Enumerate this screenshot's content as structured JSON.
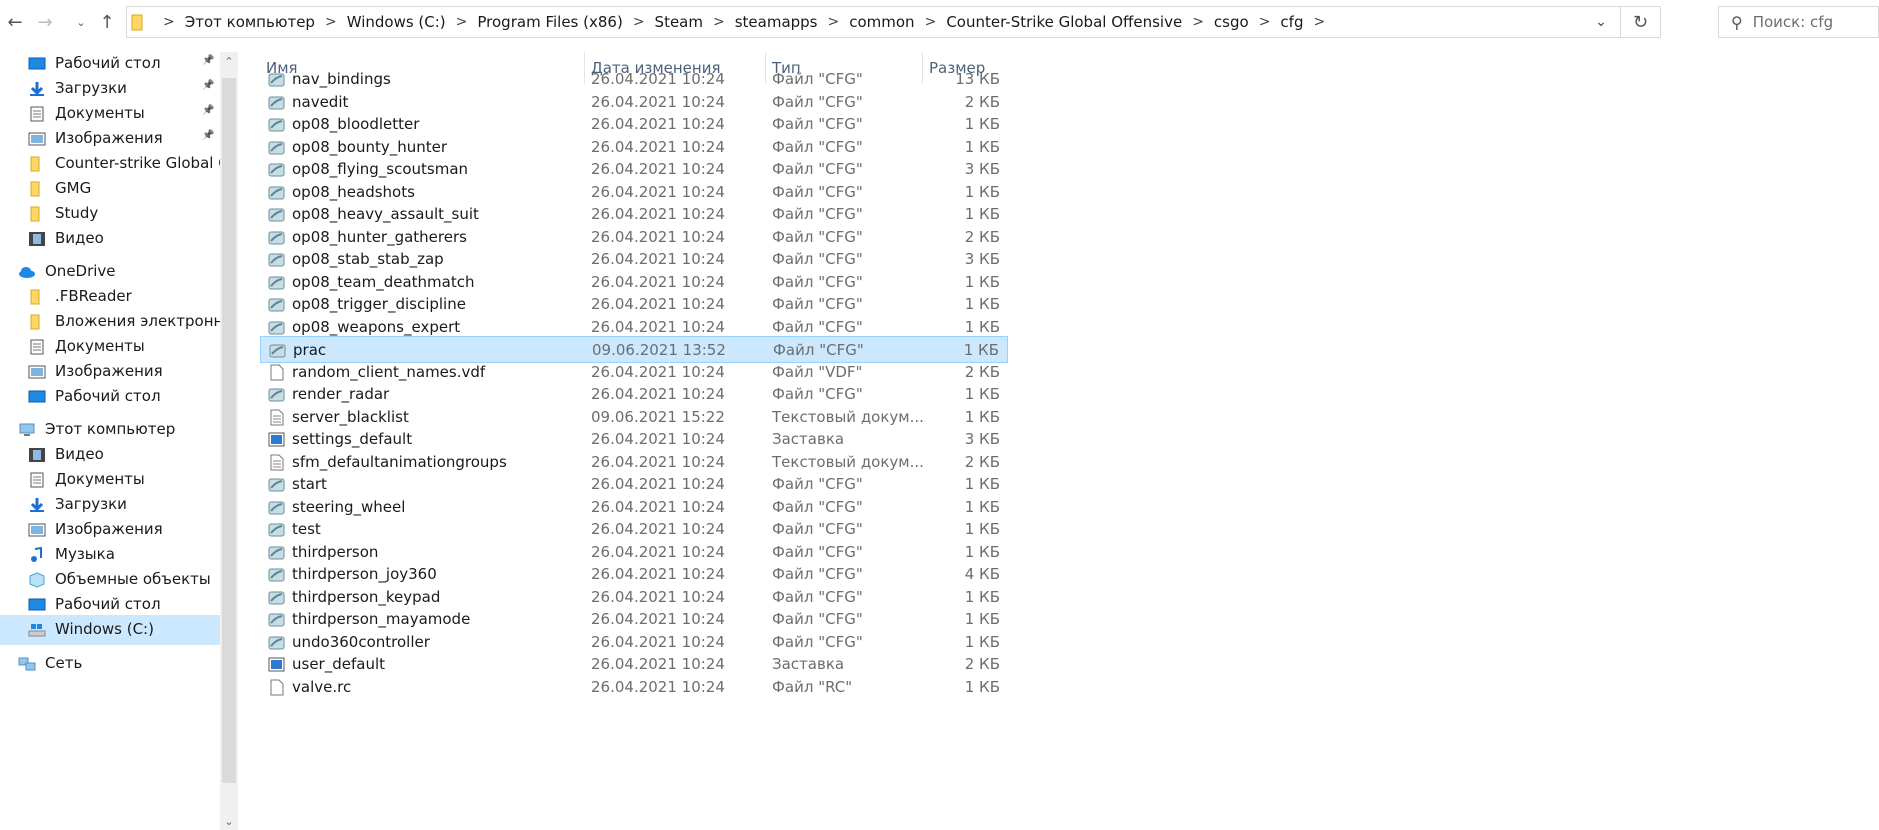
{
  "addressbar": {
    "crumbs": [
      "Этот компьютер",
      "Windows (C:)",
      "Program Files (x86)",
      "Steam",
      "steamapps",
      "common",
      "Counter-Strike Global Offensive",
      "csgo",
      "cfg"
    ]
  },
  "search": {
    "placeholder": "Поиск: cfg"
  },
  "sidebar": {
    "items": [
      {
        "label": "Рабочий стол",
        "icon": "desktop-icon",
        "pinned": true
      },
      {
        "label": "Загрузки",
        "icon": "downloads-icon",
        "pinned": true
      },
      {
        "label": "Документы",
        "icon": "documents-icon",
        "pinned": true
      },
      {
        "label": "Изображения",
        "icon": "pictures-icon",
        "pinned": true
      },
      {
        "label": "Counter-strike  Global Of",
        "icon": "folder-icon",
        "pinned": false
      },
      {
        "label": "GMG",
        "icon": "folder-icon",
        "pinned": false
      },
      {
        "label": "Study",
        "icon": "folder-icon",
        "pinned": false
      },
      {
        "label": "Видео",
        "icon": "videos-icon",
        "pinned": false
      },
      {
        "label": "OneDrive",
        "icon": "onedrive-icon",
        "pinned": false
      },
      {
        "label": ".FBReader",
        "icon": "folder-icon",
        "pinned": false
      },
      {
        "label": "Вложения электронной",
        "icon": "folder-icon",
        "pinned": false
      },
      {
        "label": "Документы",
        "icon": "documents-icon",
        "pinned": false
      },
      {
        "label": "Изображения",
        "icon": "pictures-icon",
        "pinned": false
      },
      {
        "label": "Рабочий стол",
        "icon": "desktop-icon",
        "pinned": false
      },
      {
        "label": "Этот компьютер",
        "icon": "this-pc-icon",
        "pinned": false
      },
      {
        "label": "Видео",
        "icon": "videos-icon",
        "pinned": false
      },
      {
        "label": "Документы",
        "icon": "documents-icon",
        "pinned": false
      },
      {
        "label": "Загрузки",
        "icon": "downloads-icon",
        "pinned": false
      },
      {
        "label": "Изображения",
        "icon": "pictures-icon",
        "pinned": false
      },
      {
        "label": "Музыка",
        "icon": "music-icon",
        "pinned": false
      },
      {
        "label": "Объемные объекты",
        "icon": "3d-objects-icon",
        "pinned": false
      },
      {
        "label": "Рабочий стол",
        "icon": "desktop-icon",
        "pinned": false
      },
      {
        "label": "Windows (C:)",
        "icon": "drive-icon",
        "pinned": false,
        "selected": true
      },
      {
        "label": "Сеть",
        "icon": "network-icon",
        "pinned": false
      }
    ]
  },
  "columns": {
    "name": "Имя",
    "date": "Дата изменения",
    "type": "Тип",
    "size": "Размер"
  },
  "files": [
    {
      "name": "nav_bindings",
      "date": "26.04.2021 10:24",
      "type": "Файл \"CFG\"",
      "size": "13 КБ",
      "icon": "cfg"
    },
    {
      "name": "navedit",
      "date": "26.04.2021 10:24",
      "type": "Файл \"CFG\"",
      "size": "2 КБ",
      "icon": "cfg"
    },
    {
      "name": "op08_bloodletter",
      "date": "26.04.2021 10:24",
      "type": "Файл \"CFG\"",
      "size": "1 КБ",
      "icon": "cfg"
    },
    {
      "name": "op08_bounty_hunter",
      "date": "26.04.2021 10:24",
      "type": "Файл \"CFG\"",
      "size": "1 КБ",
      "icon": "cfg"
    },
    {
      "name": "op08_flying_scoutsman",
      "date": "26.04.2021 10:24",
      "type": "Файл \"CFG\"",
      "size": "3 КБ",
      "icon": "cfg"
    },
    {
      "name": "op08_headshots",
      "date": "26.04.2021 10:24",
      "type": "Файл \"CFG\"",
      "size": "1 КБ",
      "icon": "cfg"
    },
    {
      "name": "op08_heavy_assault_suit",
      "date": "26.04.2021 10:24",
      "type": "Файл \"CFG\"",
      "size": "1 КБ",
      "icon": "cfg"
    },
    {
      "name": "op08_hunter_gatherers",
      "date": "26.04.2021 10:24",
      "type": "Файл \"CFG\"",
      "size": "2 КБ",
      "icon": "cfg"
    },
    {
      "name": "op08_stab_stab_zap",
      "date": "26.04.2021 10:24",
      "type": "Файл \"CFG\"",
      "size": "3 КБ",
      "icon": "cfg"
    },
    {
      "name": "op08_team_deathmatch",
      "date": "26.04.2021 10:24",
      "type": "Файл \"CFG\"",
      "size": "1 КБ",
      "icon": "cfg"
    },
    {
      "name": "op08_trigger_discipline",
      "date": "26.04.2021 10:24",
      "type": "Файл \"CFG\"",
      "size": "1 КБ",
      "icon": "cfg"
    },
    {
      "name": "op08_weapons_expert",
      "date": "26.04.2021 10:24",
      "type": "Файл \"CFG\"",
      "size": "1 КБ",
      "icon": "cfg"
    },
    {
      "name": "prac",
      "date": "09.06.2021 13:52",
      "type": "Файл \"CFG\"",
      "size": "1 КБ",
      "icon": "cfg",
      "selected": true
    },
    {
      "name": "random_client_names.vdf",
      "date": "26.04.2021 10:24",
      "type": "Файл \"VDF\"",
      "size": "2 КБ",
      "icon": "blank"
    },
    {
      "name": "render_radar",
      "date": "26.04.2021 10:24",
      "type": "Файл \"CFG\"",
      "size": "1 КБ",
      "icon": "cfg"
    },
    {
      "name": "server_blacklist",
      "date": "09.06.2021 15:22",
      "type": "Текстовый докум...",
      "size": "1 КБ",
      "icon": "text"
    },
    {
      "name": "settings_default",
      "date": "26.04.2021 10:24",
      "type": "Заставка",
      "size": "3 КБ",
      "icon": "screensaver"
    },
    {
      "name": "sfm_defaultanimationgroups",
      "date": "26.04.2021 10:24",
      "type": "Текстовый докум...",
      "size": "2 КБ",
      "icon": "text"
    },
    {
      "name": "start",
      "date": "26.04.2021 10:24",
      "type": "Файл \"CFG\"",
      "size": "1 КБ",
      "icon": "cfg"
    },
    {
      "name": "steering_wheel",
      "date": "26.04.2021 10:24",
      "type": "Файл \"CFG\"",
      "size": "1 КБ",
      "icon": "cfg"
    },
    {
      "name": "test",
      "date": "26.04.2021 10:24",
      "type": "Файл \"CFG\"",
      "size": "1 КБ",
      "icon": "cfg"
    },
    {
      "name": "thirdperson",
      "date": "26.04.2021 10:24",
      "type": "Файл \"CFG\"",
      "size": "1 КБ",
      "icon": "cfg"
    },
    {
      "name": "thirdperson_joy360",
      "date": "26.04.2021 10:24",
      "type": "Файл \"CFG\"",
      "size": "4 КБ",
      "icon": "cfg"
    },
    {
      "name": "thirdperson_keypad",
      "date": "26.04.2021 10:24",
      "type": "Файл \"CFG\"",
      "size": "1 КБ",
      "icon": "cfg"
    },
    {
      "name": "thirdperson_mayamode",
      "date": "26.04.2021 10:24",
      "type": "Файл \"CFG\"",
      "size": "1 КБ",
      "icon": "cfg"
    },
    {
      "name": "undo360controller",
      "date": "26.04.2021 10:24",
      "type": "Файл \"CFG\"",
      "size": "1 КБ",
      "icon": "cfg"
    },
    {
      "name": "user_default",
      "date": "26.04.2021 10:24",
      "type": "Заставка",
      "size": "2 КБ",
      "icon": "screensaver"
    },
    {
      "name": "valve.rc",
      "date": "26.04.2021 10:24",
      "type": "Файл \"RC\"",
      "size": "1 КБ",
      "icon": "blank"
    }
  ],
  "colors": {
    "selection_bg": "#cce8ff",
    "selection_border": "#99d1ff",
    "header_text": "#4c607a",
    "folder_yellow": "#ffd766"
  }
}
